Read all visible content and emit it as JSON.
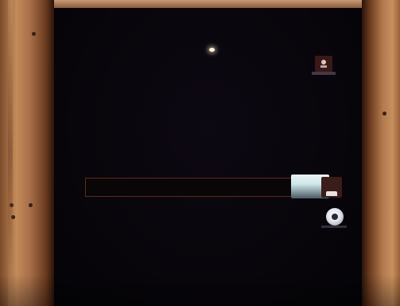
{
  "screen": {
    "background_color": "#07050a"
  },
  "desktop": {
    "icon_name": "application-icon"
  },
  "login": {
    "password_value": "",
    "password_placeholder": "",
    "submit_icon": "arrow-right-icon",
    "user_icon": "user-icon",
    "power_icon": "power-icon"
  },
  "frame": {
    "wood_color": "#c48a5a"
  }
}
